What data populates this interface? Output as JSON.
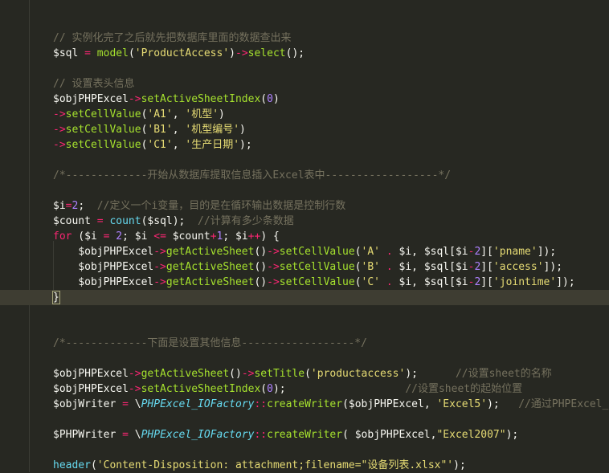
{
  "editor": {
    "lines": [
      {
        "i": 2,
        "tokens": [
          [
            "c",
            "// 实例化完了之后就先把数据库里面的数据查出来"
          ]
        ]
      },
      {
        "i": 3,
        "tokens": [
          [
            "v",
            "$sql"
          ],
          [
            "p",
            " "
          ],
          [
            "o",
            "="
          ],
          [
            "p",
            " "
          ],
          [
            "f",
            "model"
          ],
          [
            "p",
            "("
          ],
          [
            "s",
            "'ProductAccess'"
          ],
          [
            "p",
            ")"
          ],
          [
            "o",
            "->"
          ],
          [
            "f",
            "select"
          ],
          [
            "p",
            "();"
          ]
        ]
      },
      {
        "i": 5,
        "tokens": [
          [
            "c",
            "// 设置表头信息"
          ]
        ]
      },
      {
        "i": 6,
        "tokens": [
          [
            "v",
            "$objPHPExcel"
          ],
          [
            "o",
            "->"
          ],
          [
            "f",
            "setActiveSheetIndex"
          ],
          [
            "p",
            "("
          ],
          [
            "n",
            "0"
          ],
          [
            "p",
            ")"
          ]
        ]
      },
      {
        "i": 7,
        "tokens": [
          [
            "o",
            "->"
          ],
          [
            "f",
            "setCellValue"
          ],
          [
            "p",
            "("
          ],
          [
            "s",
            "'A1'"
          ],
          [
            "p",
            ", "
          ],
          [
            "s",
            "'机型'"
          ],
          [
            "p",
            ")"
          ]
        ]
      },
      {
        "i": 8,
        "tokens": [
          [
            "o",
            "->"
          ],
          [
            "f",
            "setCellValue"
          ],
          [
            "p",
            "("
          ],
          [
            "s",
            "'B1'"
          ],
          [
            "p",
            ", "
          ],
          [
            "s",
            "'机型编号'"
          ],
          [
            "p",
            ")"
          ]
        ]
      },
      {
        "i": 9,
        "tokens": [
          [
            "o",
            "->"
          ],
          [
            "f",
            "setCellValue"
          ],
          [
            "p",
            "("
          ],
          [
            "s",
            "'C1'"
          ],
          [
            "p",
            ", "
          ],
          [
            "s",
            "'生产日期'"
          ],
          [
            "p",
            ");"
          ]
        ]
      },
      {
        "i": 11,
        "tokens": [
          [
            "c",
            "/*-------------开始从数据库提取信息插入Excel表中------------------*/"
          ]
        ]
      },
      {
        "i": 13,
        "tokens": [
          [
            "v",
            "$i"
          ],
          [
            "o",
            "="
          ],
          [
            "n",
            "2"
          ],
          [
            "p",
            ";  "
          ],
          [
            "c",
            "//定义一个i变量，目的是在循环输出数据是控制行数"
          ]
        ]
      },
      {
        "i": 14,
        "tokens": [
          [
            "v",
            "$count"
          ],
          [
            "p",
            " "
          ],
          [
            "o",
            "="
          ],
          [
            "p",
            " "
          ],
          [
            "b",
            "count"
          ],
          [
            "p",
            "("
          ],
          [
            "v",
            "$sql"
          ],
          [
            "p",
            ");  "
          ],
          [
            "c",
            "//计算有多少条数据"
          ]
        ]
      },
      {
        "i": 15,
        "tokens": [
          [
            "k",
            "for"
          ],
          [
            "p",
            " ("
          ],
          [
            "v",
            "$i"
          ],
          [
            "p",
            " "
          ],
          [
            "o",
            "="
          ],
          [
            "p",
            " "
          ],
          [
            "n",
            "2"
          ],
          [
            "p",
            "; "
          ],
          [
            "v",
            "$i"
          ],
          [
            "p",
            " "
          ],
          [
            "o",
            "<="
          ],
          [
            "p",
            " "
          ],
          [
            "v",
            "$count"
          ],
          [
            "o",
            "+"
          ],
          [
            "n",
            "1"
          ],
          [
            "p",
            "; "
          ],
          [
            "v",
            "$i"
          ],
          [
            "o",
            "++"
          ],
          [
            "p",
            ") {"
          ]
        ]
      },
      {
        "i": 16,
        "tokens": [
          [
            "p",
            "    "
          ],
          [
            "v",
            "$objPHPExcel"
          ],
          [
            "o",
            "->"
          ],
          [
            "f",
            "getActiveSheet"
          ],
          [
            "p",
            "()"
          ],
          [
            "o",
            "->"
          ],
          [
            "f",
            "setCellValue"
          ],
          [
            "p",
            "("
          ],
          [
            "s",
            "'A'"
          ],
          [
            "p",
            " "
          ],
          [
            "o",
            "."
          ],
          [
            "p",
            " "
          ],
          [
            "v",
            "$i"
          ],
          [
            "p",
            ", "
          ],
          [
            "v",
            "$sql"
          ],
          [
            "p",
            "["
          ],
          [
            "v",
            "$i"
          ],
          [
            "o",
            "-"
          ],
          [
            "n",
            "2"
          ],
          [
            "p",
            "]["
          ],
          [
            "s",
            "'pname'"
          ],
          [
            "p",
            "]);"
          ]
        ]
      },
      {
        "i": 17,
        "tokens": [
          [
            "p",
            "    "
          ],
          [
            "v",
            "$objPHPExcel"
          ],
          [
            "o",
            "->"
          ],
          [
            "f",
            "getActiveSheet"
          ],
          [
            "p",
            "()"
          ],
          [
            "o",
            "->"
          ],
          [
            "f",
            "setCellValue"
          ],
          [
            "p",
            "("
          ],
          [
            "s",
            "'B'"
          ],
          [
            "p",
            " "
          ],
          [
            "o",
            "."
          ],
          [
            "p",
            " "
          ],
          [
            "v",
            "$i"
          ],
          [
            "p",
            ", "
          ],
          [
            "v",
            "$sql"
          ],
          [
            "p",
            "["
          ],
          [
            "v",
            "$i"
          ],
          [
            "o",
            "-"
          ],
          [
            "n",
            "2"
          ],
          [
            "p",
            "]["
          ],
          [
            "s",
            "'access'"
          ],
          [
            "p",
            "]);"
          ]
        ]
      },
      {
        "i": 18,
        "tokens": [
          [
            "p",
            "    "
          ],
          [
            "v",
            "$objPHPExcel"
          ],
          [
            "o",
            "->"
          ],
          [
            "f",
            "getActiveSheet"
          ],
          [
            "p",
            "()"
          ],
          [
            "o",
            "->"
          ],
          [
            "f",
            "setCellValue"
          ],
          [
            "p",
            "("
          ],
          [
            "s",
            "'C'"
          ],
          [
            "p",
            " "
          ],
          [
            "o",
            "."
          ],
          [
            "p",
            " "
          ],
          [
            "v",
            "$i"
          ],
          [
            "p",
            ", "
          ],
          [
            "v",
            "$sql"
          ],
          [
            "p",
            "["
          ],
          [
            "v",
            "$i"
          ],
          [
            "o",
            "-"
          ],
          [
            "n",
            "2"
          ],
          [
            "p",
            "]["
          ],
          [
            "s",
            "'jointime'"
          ],
          [
            "p",
            "]);"
          ]
        ]
      },
      {
        "i": 19,
        "current": true,
        "tokens": [
          [
            "cur",
            "}"
          ]
        ]
      },
      {
        "i": 22,
        "tokens": [
          [
            "c",
            "/*-------------下面是设置其他信息------------------*/"
          ]
        ]
      },
      {
        "i": 24,
        "tokens": [
          [
            "v",
            "$objPHPExcel"
          ],
          [
            "o",
            "->"
          ],
          [
            "f",
            "getActiveSheet"
          ],
          [
            "p",
            "()"
          ],
          [
            "o",
            "->"
          ],
          [
            "f",
            "setTitle"
          ],
          [
            "p",
            "("
          ],
          [
            "s",
            "'productaccess'"
          ],
          [
            "p",
            ");      "
          ],
          [
            "c",
            "//设置sheet的名称"
          ]
        ]
      },
      {
        "i": 25,
        "tokens": [
          [
            "v",
            "$objPHPExcel"
          ],
          [
            "o",
            "->"
          ],
          [
            "f",
            "setActiveSheetIndex"
          ],
          [
            "p",
            "("
          ],
          [
            "n",
            "0"
          ],
          [
            "p",
            ");                   "
          ],
          [
            "c",
            "//设置sheet的起始位置"
          ]
        ]
      },
      {
        "i": 26,
        "tokens": [
          [
            "v",
            "$objWriter"
          ],
          [
            "p",
            " "
          ],
          [
            "o",
            "="
          ],
          [
            "p",
            " \\"
          ],
          [
            "t",
            "PHPExcel_IOFactory"
          ],
          [
            "o",
            "::"
          ],
          [
            "f",
            "createWriter"
          ],
          [
            "p",
            "("
          ],
          [
            "v",
            "$objPHPExcel"
          ],
          [
            "p",
            ", "
          ],
          [
            "s",
            "'Excel5'"
          ],
          [
            "p",
            ");   "
          ],
          [
            "c",
            "//通过PHPExcel_IO"
          ]
        ]
      },
      {
        "i": 28,
        "tokens": [
          [
            "v",
            "$PHPWriter"
          ],
          [
            "p",
            " "
          ],
          [
            "o",
            "="
          ],
          [
            "p",
            " \\"
          ],
          [
            "t",
            "PHPExcel_IOFactory"
          ],
          [
            "o",
            "::"
          ],
          [
            "f",
            "createWriter"
          ],
          [
            "p",
            "( "
          ],
          [
            "v",
            "$objPHPExcel"
          ],
          [
            "p",
            ","
          ],
          [
            "s",
            "\"Excel2007\""
          ],
          [
            "p",
            ");"
          ]
        ]
      },
      {
        "i": 30,
        "tokens": [
          [
            "b",
            "header"
          ],
          [
            "p",
            "("
          ],
          [
            "s",
            "'Content-Disposition: attachment;filename=\"设备列表.xlsx\"'"
          ],
          [
            "p",
            ");"
          ]
        ]
      }
    ]
  },
  "colors": {
    "background": "#272822",
    "comment": "#75715e",
    "function": "#a6e22e",
    "string": "#e6db74",
    "operator": "#f92672",
    "number": "#ae81ff",
    "class": "#66d9ef",
    "text": "#f8f8f2",
    "current_line": "#3e3d32"
  }
}
